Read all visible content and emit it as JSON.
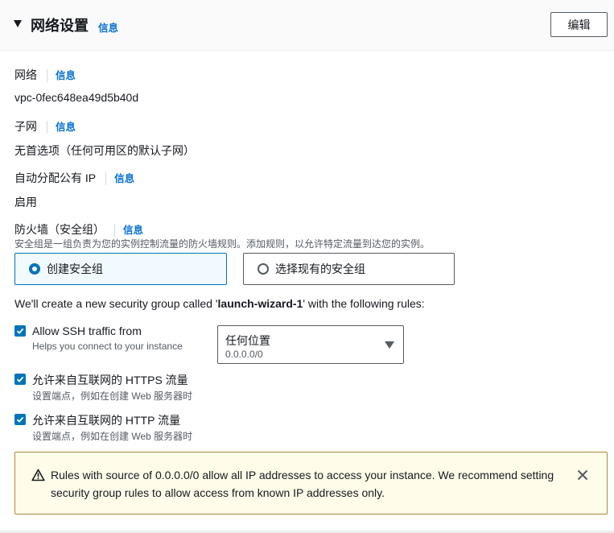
{
  "header": {
    "title": "网络设置",
    "info": "信息",
    "edit_label": "编辑"
  },
  "fields": {
    "network": {
      "label": "网络",
      "info": "信息",
      "value": "vpc-0fec648ea49d5b40d"
    },
    "subnet": {
      "label": "子网",
      "info": "信息",
      "value": "无首选项（任何可用区的默认子网）"
    },
    "public_ip": {
      "label": "自动分配公有 IP",
      "info": "信息",
      "value": "启用"
    },
    "firewall": {
      "label": "防火墙（安全组）",
      "info": "信息",
      "description": "安全组是一组负责为您的实例控制流量的防火墙规则。添加规则，以允许特定流量到达您的实例。"
    }
  },
  "security_group_options": [
    {
      "label": "创建安全组",
      "selected": true
    },
    {
      "label": "选择现有的安全组",
      "selected": false
    }
  ],
  "intro": {
    "prefix": "We'll create a new security group called '",
    "group_name": "launch-wizard-1",
    "suffix": "' with the following rules:"
  },
  "rules": {
    "ssh": {
      "label": "Allow SSH traffic from",
      "description": "Helps you connect to your instance",
      "checked": true
    },
    "https": {
      "label": "允许来自互联网的 HTTPS 流量",
      "description": "设置端点，例如在创建 Web 服务器时",
      "checked": true
    },
    "http": {
      "label": "允许来自互联网的 HTTP 流量",
      "description": "设置端点，例如在创建 Web 服务器时",
      "checked": true
    }
  },
  "ssh_source_select": {
    "value": "任何位置",
    "description": "0.0.0.0/0"
  },
  "warning": {
    "text": "Rules with source of 0.0.0.0/0 allow all IP addresses to access your instance. We recommend setting security group rules to allow access from known IP addresses only."
  },
  "colors": {
    "accent": "#0073bb",
    "link": "#0972d3",
    "warning_bg": "#fffce9",
    "warning_border": "#a9893c"
  },
  "icons": {
    "section_toggle": "caret-down-icon",
    "warning": "warning-triangle-icon",
    "dismiss": "close-icon",
    "dropdown": "caret-down-icon",
    "checkbox": "checkmark-icon"
  }
}
